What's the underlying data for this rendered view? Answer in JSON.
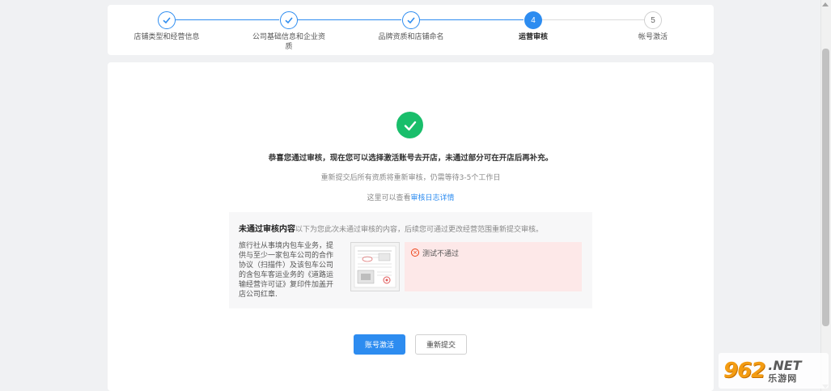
{
  "steps": [
    {
      "number": "1",
      "label": "店铺类型和经营信息",
      "status": "done"
    },
    {
      "number": "2",
      "label": "公司基础信息和企业资质",
      "status": "done"
    },
    {
      "number": "3",
      "label": "品牌资质和店铺命名",
      "status": "done"
    },
    {
      "number": "4",
      "label": "运营审核",
      "status": "active"
    },
    {
      "number": "5",
      "label": "帐号激活",
      "status": "pending"
    }
  ],
  "result": {
    "main_message": "恭喜您通过审核，现在您可以选择激活账号去开店，未通过部分可在开店后再补充。",
    "sub_message": "重新提交后所有资质将重新审核，仍需等待3-5个工作日",
    "log_prefix": "这里可以查看",
    "log_link": "审核日志详情"
  },
  "rejection": {
    "title": "未通过审核内容",
    "description": "以下为您此次未通过审核的内容，后续您可通过更改经营范围重新提交审核。",
    "item_text": "旅行社从事境内包车业务，提供与至少一家包车公司的合作协议（扫描件）及该包车公司的含包车客运业务的《道路运输经营许可证》复印件加盖开店公司红章.",
    "reason": "测试不通过"
  },
  "buttons": {
    "activate": "账号激活",
    "resubmit": "重新提交"
  },
  "watermark": {
    "number": "962",
    "suffix": ".NET",
    "site": "乐游网"
  },
  "colors": {
    "primary": "#2d8cf0",
    "success": "#19be6b",
    "error": "#ed4014"
  }
}
